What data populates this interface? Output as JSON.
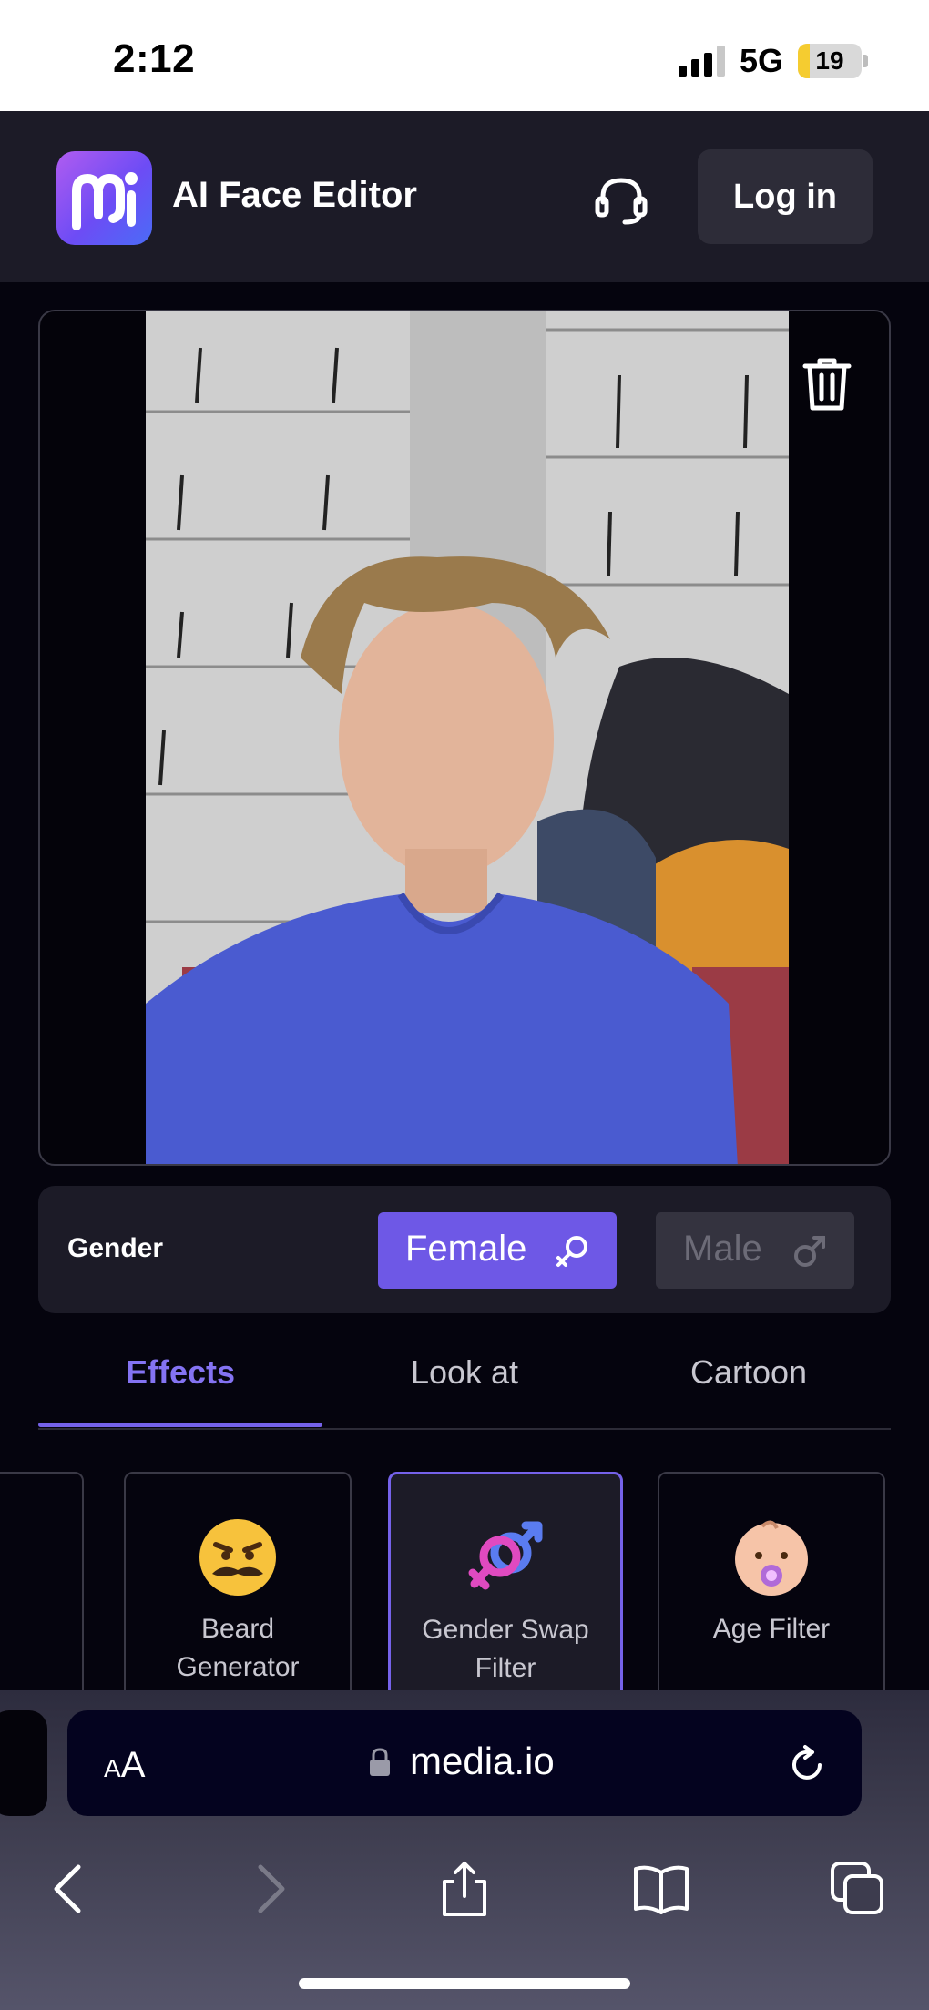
{
  "status_bar": {
    "time": "2:12",
    "network": "5G",
    "battery": "19",
    "battery_level": 0.19
  },
  "app": {
    "title": "AI Face Editor",
    "login_label": "Log in"
  },
  "gender": {
    "label": "Gender",
    "options": [
      "Female",
      "Male"
    ],
    "selected": "Female"
  },
  "tabs": [
    {
      "label": "Effects",
      "active": true
    },
    {
      "label": "Look at",
      "active": false
    },
    {
      "label": "Cartoon",
      "active": false
    }
  ],
  "effects": [
    {
      "label": "Beard Generator",
      "icon": "mustache-face-emoji",
      "selected": false
    },
    {
      "label": "Gender Swap Filter",
      "icon": "gender-swap-emoji",
      "selected": true
    },
    {
      "label": "Age Filter",
      "icon": "baby-face-emoji",
      "selected": false
    }
  ],
  "browser": {
    "text_size": "AA",
    "url": "media.io"
  },
  "colors": {
    "accent": "#6e58e6",
    "tab_active": "#8473f2",
    "background": "#05040e",
    "panel": "#1c1b27"
  }
}
